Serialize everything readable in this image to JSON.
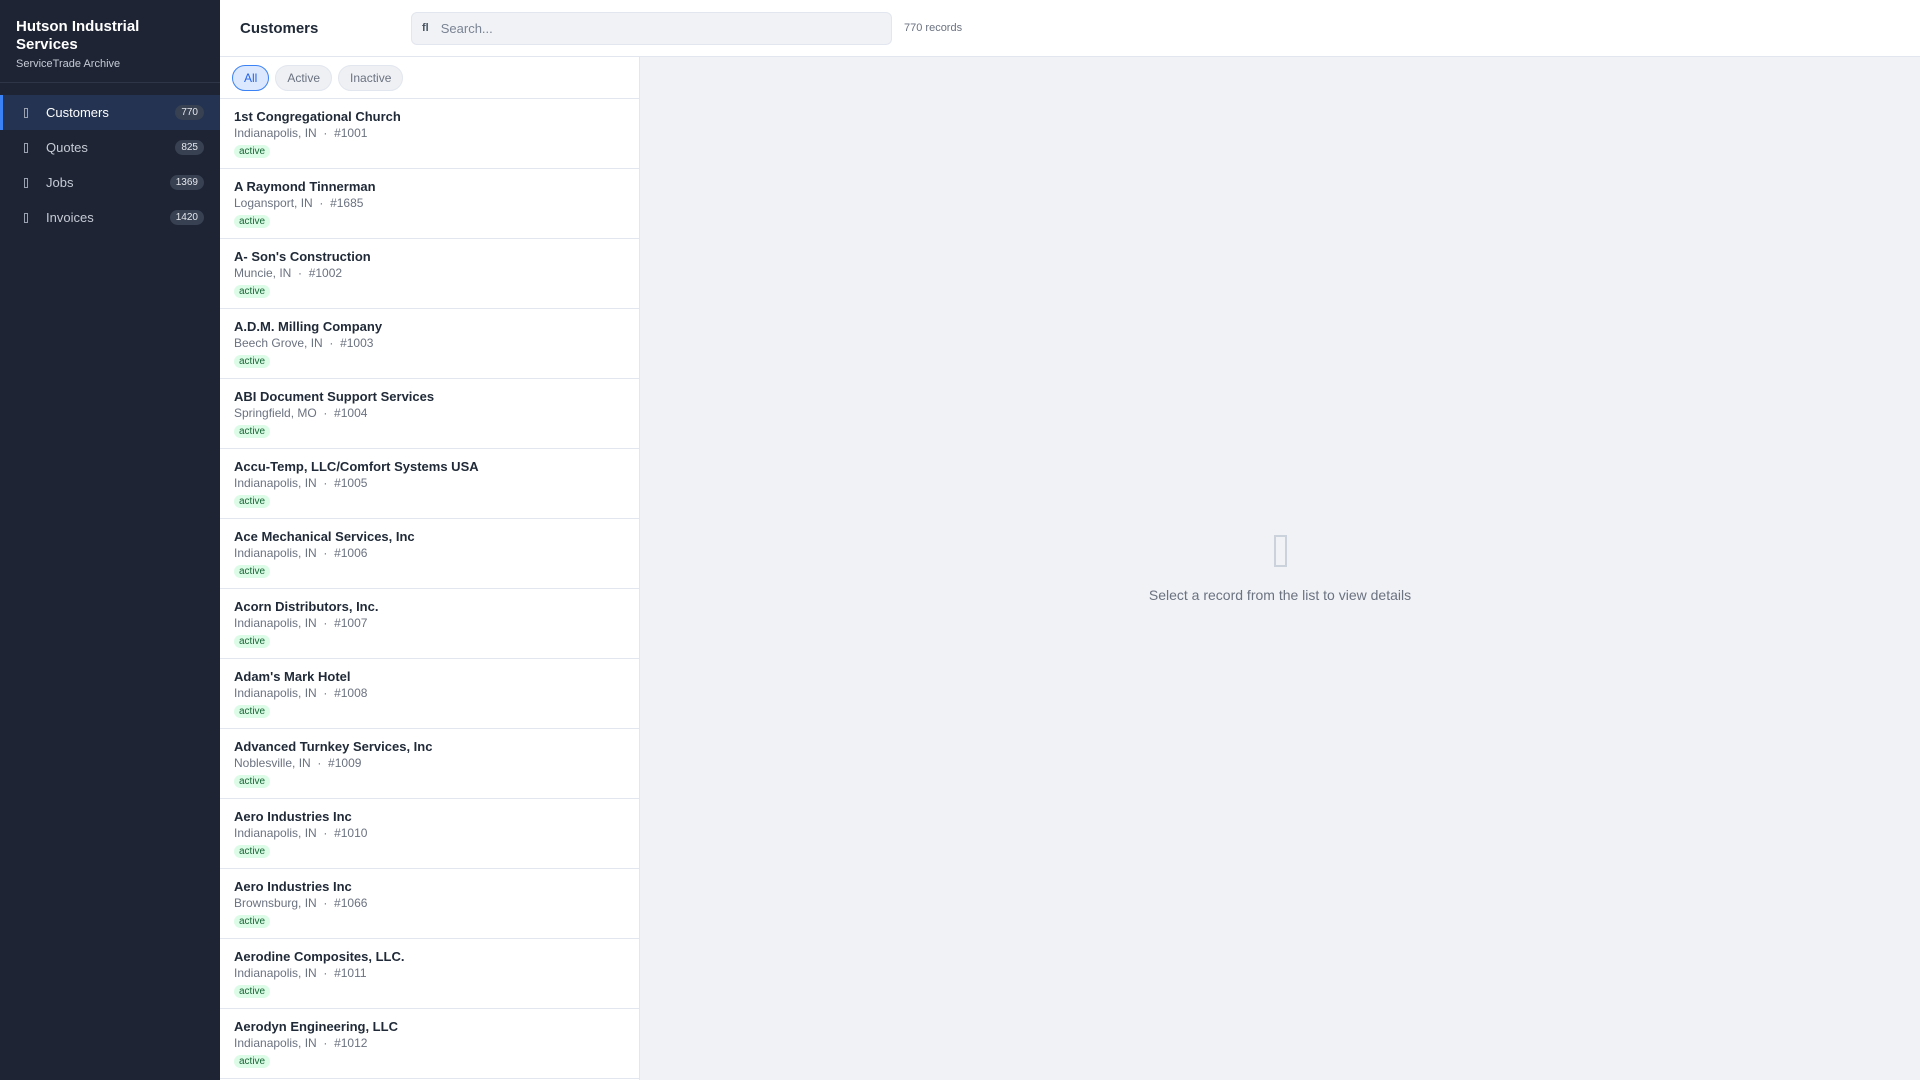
{
  "brand": {
    "title": "Hutson Industrial Services",
    "subtitle": "ServiceTrade Archive"
  },
  "nav": [
    {
      "label": "Customers",
      "count": "770"
    },
    {
      "label": "Quotes",
      "count": "825"
    },
    {
      "label": "Jobs",
      "count": "1369"
    },
    {
      "label": "Invoices",
      "count": "1420"
    }
  ],
  "header": {
    "title": "Customers",
    "search_placeholder": "Search...",
    "search_icon": "fl",
    "records": "770 records"
  },
  "filters": [
    "All",
    "Active",
    "Inactive"
  ],
  "rows": [
    {
      "name": "1st Congregational Church",
      "city": "Indianapolis, IN",
      "id": "#1001",
      "status": "active"
    },
    {
      "name": "A Raymond Tinnerman",
      "city": "Logansport, IN",
      "id": "#1685",
      "status": "active"
    },
    {
      "name": "A- Son's Construction",
      "city": "Muncie, IN",
      "id": "#1002",
      "status": "active"
    },
    {
      "name": "A.D.M. Milling Company",
      "city": "Beech Grove, IN",
      "id": "#1003",
      "status": "active"
    },
    {
      "name": "ABI Document Support Services",
      "city": "Springfield, MO",
      "id": "#1004",
      "status": "active"
    },
    {
      "name": "Accu-Temp, LLC/Comfort Systems USA",
      "city": "Indianapolis, IN",
      "id": "#1005",
      "status": "active"
    },
    {
      "name": "Ace Mechanical Services, Inc",
      "city": "Indianapolis, IN",
      "id": "#1006",
      "status": "active"
    },
    {
      "name": "Acorn Distributors, Inc.",
      "city": "Indianapolis, IN",
      "id": "#1007",
      "status": "active"
    },
    {
      "name": "Adam's Mark Hotel",
      "city": "Indianapolis, IN",
      "id": "#1008",
      "status": "active"
    },
    {
      "name": "Advanced Turnkey Services, Inc",
      "city": "Noblesville, IN",
      "id": "#1009",
      "status": "active"
    },
    {
      "name": "Aero Industries Inc",
      "city": "Indianapolis, IN",
      "id": "#1010",
      "status": "active"
    },
    {
      "name": "Aero Industries Inc",
      "city": "Brownsburg, IN",
      "id": "#1066",
      "status": "active"
    },
    {
      "name": "Aerodine Composites, LLC.",
      "city": "Indianapolis, IN",
      "id": "#1011",
      "status": "active"
    },
    {
      "name": "Aerodyn Engineering, LLC",
      "city": "Indianapolis, IN",
      "id": "#1012",
      "status": "active"
    }
  ],
  "detail": {
    "empty_text": "Select a record from the list to view details"
  }
}
